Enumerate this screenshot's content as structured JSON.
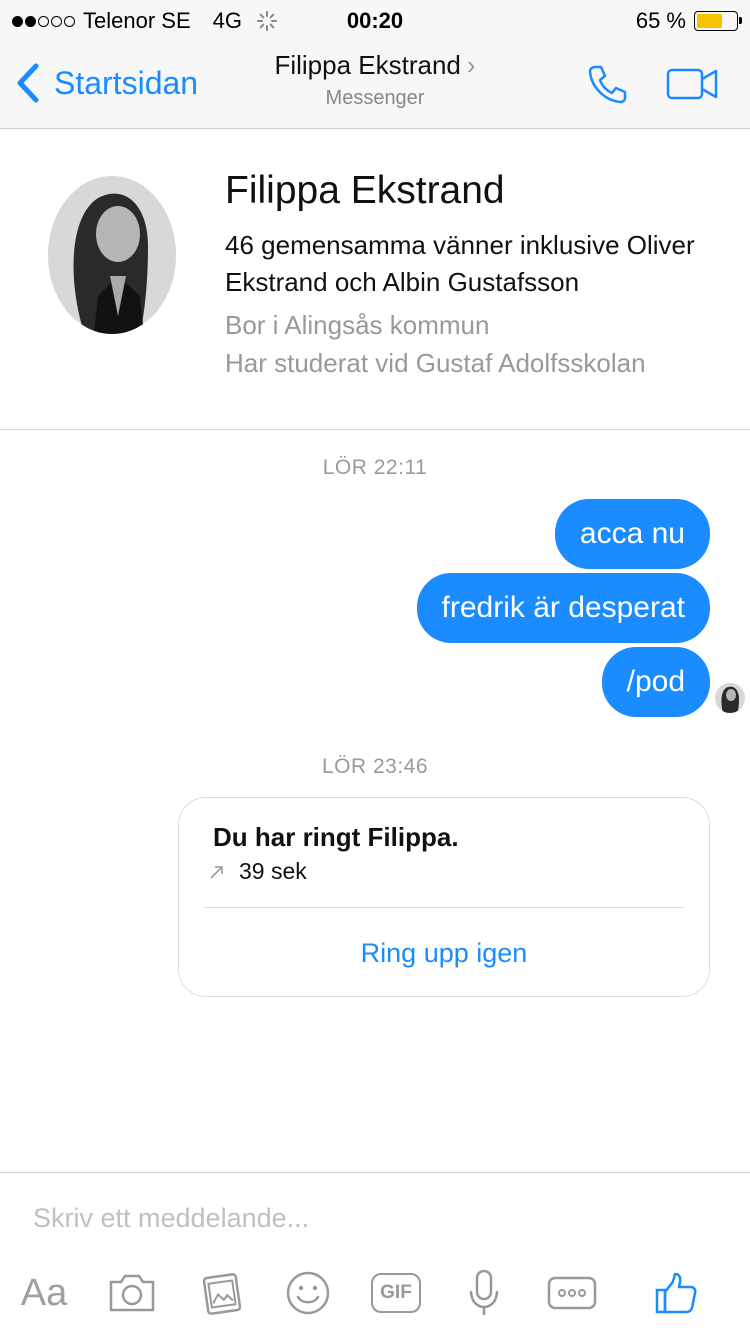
{
  "status": {
    "carrier": "Telenor SE",
    "network": "4G",
    "time": "00:20",
    "battery": "65 %"
  },
  "nav": {
    "back_label": "Startsidan",
    "title": "Filippa Ekstrand",
    "subtitle": "Messenger"
  },
  "profile": {
    "name": "Filippa Ekstrand",
    "mutual": "46 gemensamma vänner inklusive Oliver Ekstrand och Albin Gustafsson",
    "lives": "Bor i Alingsås kommun",
    "studied": "Har studerat vid Gustaf Adolfsskolan"
  },
  "thread": {
    "ts1": "LÖR 22:11",
    "messages": [
      "acca nu",
      "fredrik är desperat",
      "/pod"
    ],
    "ts2": "LÖR 23:46",
    "call": {
      "title": "Du har ringt Filippa.",
      "duration": "39 sek",
      "action": "Ring upp igen"
    }
  },
  "composer": {
    "placeholder": "Skriv ett meddelande...",
    "aa_label": "Aa",
    "gif_label": "GIF"
  },
  "colors": {
    "accent": "#1a8cff",
    "battery": "#f5c400"
  }
}
